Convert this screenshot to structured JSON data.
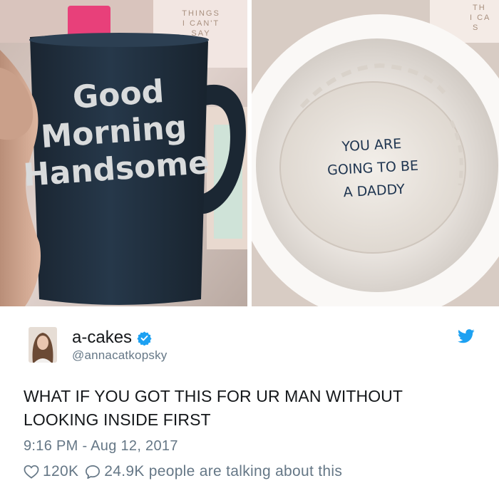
{
  "photos": {
    "left": {
      "mug_text": [
        "Good",
        "Morning",
        "Handsome"
      ],
      "card_text": [
        "THINGS",
        "I CAN'T",
        "SAY"
      ]
    },
    "right": {
      "mug_inside_text": [
        "YOU ARE",
        "GOING TO BE",
        "A DADDY"
      ],
      "corner_text": [
        "TH",
        "I CA",
        "S"
      ]
    }
  },
  "tweet": {
    "display_name": "a-cakes",
    "handle": "@annacatkopsky",
    "text": "WHAT IF YOU GOT THIS FOR UR MAN WITHOUT LOOKING INSIDE FIRST",
    "timestamp": "9:16 PM - Aug 12, 2017",
    "likes": "120K",
    "replies_summary": "24.9K people are talking about this"
  },
  "icons": {
    "verified": "verified-badge-icon",
    "bird": "twitter-bird-icon",
    "heart": "heart-icon",
    "reply": "speech-bubble-icon"
  },
  "colors": {
    "twitter_blue": "#1da1f2",
    "text": "#14171a",
    "secondary_text": "#657786",
    "mug_navy": "#1f2d3a"
  }
}
